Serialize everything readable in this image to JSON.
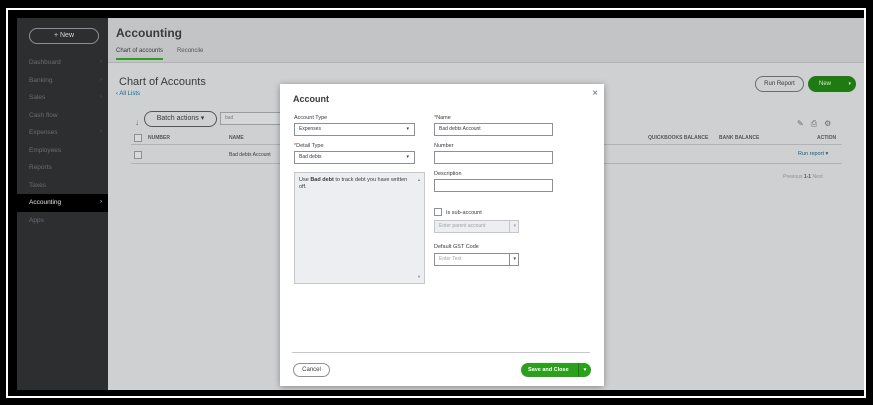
{
  "sidebar": {
    "new_label": "+ New",
    "items": [
      {
        "label": "Dashboard",
        "chev": "›"
      },
      {
        "label": "Banking",
        "chev": "›"
      },
      {
        "label": "Sales",
        "chev": "›"
      },
      {
        "label": "Cash flow",
        "chev": ""
      },
      {
        "label": "Expenses",
        "chev": "›"
      },
      {
        "label": "Employees",
        "chev": ""
      },
      {
        "label": "Reports",
        "chev": ""
      },
      {
        "label": "Taxes",
        "chev": ""
      },
      {
        "label": "Accounting",
        "chev": "›"
      },
      {
        "label": "Apps",
        "chev": ""
      }
    ],
    "active": "Accounting"
  },
  "header": {
    "title": "Accounting",
    "tabs": [
      "Chart of accounts",
      "Reconcile"
    ]
  },
  "page": {
    "title": "Chart of Accounts",
    "all_lists": "‹ All Lists",
    "run_report": "Run Report",
    "new_label": "New",
    "batch_actions": "Batch actions ▾",
    "filter_value": "bad",
    "sort_icon": "↓",
    "tool_icons": [
      "✎",
      "⎙",
      "⚙"
    ],
    "columns": [
      "NUMBER",
      "NAME",
      "QUICKBOOKS BALANCE",
      "BANK BALANCE",
      "ACTION"
    ],
    "rows": [
      {
        "number": "",
        "name": "Bad debts Account",
        "action": "Run report ▾"
      }
    ],
    "pager_prev": "Previous",
    "pager_range": "1-1",
    "pager_next": "Next"
  },
  "modal": {
    "title": "Account",
    "close": "×",
    "account_type_label": "Account Type",
    "account_type_value": "Expenses",
    "detail_type_label": "Detail Type",
    "detail_type_value": "Bad debts",
    "description_bold": "Bad debt",
    "description_pre": "Use ",
    "description_post": " to track debt you have written off.",
    "name_label": "Name",
    "name_value": "Bad debts Account",
    "number_label": "Number",
    "number_value": "",
    "description_label": "Description",
    "description_value": "",
    "sub_account_label": "Is sub-account",
    "parent_placeholder": "Enter parent account",
    "gst_label": "Default GST Code",
    "gst_placeholder": "Enter Text",
    "required_mark": "*",
    "dropdown_caret": "▾",
    "cancel": "Cancel",
    "save": "Save and Close"
  },
  "colors": {
    "accent_green": "#2ca01c",
    "sidebar_bg": "#2d2e30",
    "link_blue": "#0d6b9c"
  }
}
